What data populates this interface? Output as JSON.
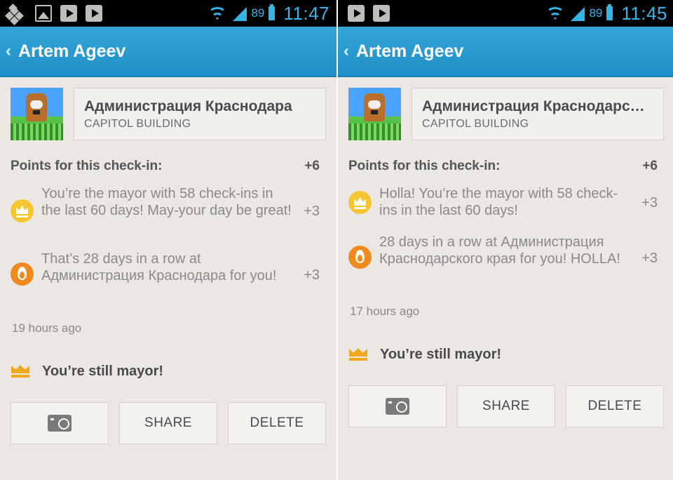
{
  "screens": [
    {
      "status_time": "11:47",
      "battery": "89",
      "title": "Artem Ageev",
      "venue_name": "Администрация Краснодара",
      "venue_category": "CAPITOL BUILDING",
      "points_label": "Points for this check-in:",
      "points_total": "+6",
      "reasons": [
        {
          "icon": "crown-icon",
          "text": "You’re the mayor with 58 check-ins in the last 60 days! May-your day be great!",
          "points": "+3"
        },
        {
          "icon": "fire-icon",
          "text": "That’s 28 days in a row at Администрация Краснодара for you!",
          "points": "+3"
        }
      ],
      "time_ago": "19 hours ago",
      "mayor_text": "You’re still mayor!",
      "buttons": {
        "share": "SHARE",
        "delete": "DELETE"
      }
    },
    {
      "status_time": "11:45",
      "battery": "89",
      "title": "Artem Ageev",
      "venue_name": "Администрация Краснодарс…",
      "venue_category": "CAPITOL BUILDING",
      "points_label": "Points for this check-in:",
      "points_total": "+6",
      "reasons": [
        {
          "icon": "crown-icon",
          "text": "Holla! You’re the mayor with 58 check-ins in the last 60 days!",
          "points": "+3"
        },
        {
          "icon": "fire-icon",
          "text": "28 days in a row at Администрация Краснодарского края for you! HOLLA!",
          "points": "+3"
        }
      ],
      "time_ago": "17 hours ago",
      "mayor_text": "You’re still mayor!",
      "buttons": {
        "share": "SHARE",
        "delete": "DELETE"
      }
    }
  ],
  "colors": {
    "accent": "#33b5e5",
    "actionbar": "#2a9bd0",
    "background": "#ebe8e3",
    "crown": "#f7c531",
    "fire": "#f18a1e"
  }
}
